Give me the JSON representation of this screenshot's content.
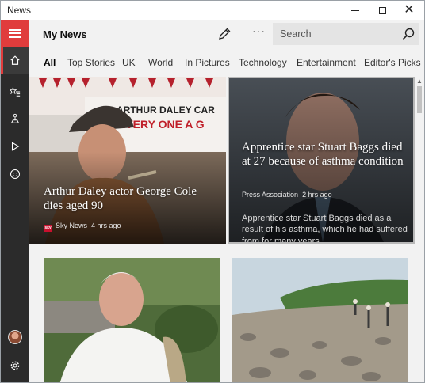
{
  "window": {
    "title": "News",
    "controls": {
      "minimize": "minimize",
      "maximize": "maximize",
      "close": "✕"
    }
  },
  "header": {
    "title": "My News",
    "more_label": "···",
    "search_placeholder": "Search"
  },
  "tabs": [
    {
      "label": "All",
      "active": true
    },
    {
      "label": "Top Stories"
    },
    {
      "label": "UK"
    },
    {
      "label": "World"
    },
    {
      "label": "In Pictures"
    },
    {
      "label": "Technology"
    },
    {
      "label": "Entertainment"
    },
    {
      "label": "Editor's Picks"
    }
  ],
  "rail": {
    "items": [
      "menu-icon",
      "home-icon",
      "favorites-icon",
      "local-icon",
      "video-icon",
      "smiley-icon",
      "avatar",
      "settings-icon"
    ],
    "accent": "#e03c3c"
  },
  "articles": [
    {
      "headline": "Arthur Daley actor George Cole dies aged 90",
      "source": "Sky News",
      "age": "4 hrs ago",
      "image_text": "ARTHUR DALEY CAR\nEVERY ONE A G"
    },
    {
      "headline": "Apprentice star Stuart Baggs died at 27 because of asthma condition",
      "source": "Press Association",
      "age": "2 hrs ago",
      "summary": "Apprentice star Stuart Baggs died as a result of his asthma, which he had suffered from for many years"
    }
  ],
  "colors": {
    "accent": "#e03c3c",
    "rail_bg": "#2b2b2b",
    "content_bg": "#f2f2f2"
  }
}
